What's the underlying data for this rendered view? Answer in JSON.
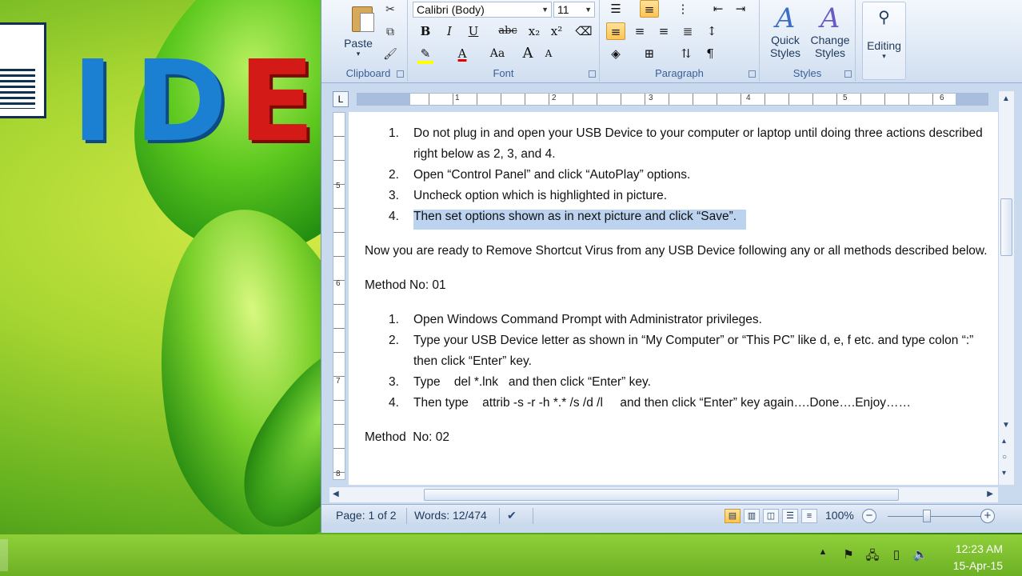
{
  "desktop": {
    "logo_letters": [
      "I",
      "D",
      "E"
    ]
  },
  "ribbon": {
    "clipboard": {
      "paste_label": "Paste",
      "group_label": "Clipboard"
    },
    "font": {
      "font_name": "Calibri (Body)",
      "font_size": "11",
      "group_label": "Font",
      "bold": "B",
      "italic": "I",
      "underline": "U",
      "strike": "abc",
      "subscript": "x₂",
      "superscript": "x²",
      "grow": "A",
      "shrink": "A",
      "change_case": "Aa"
    },
    "paragraph": {
      "group_label": "Paragraph",
      "show_marks": "¶"
    },
    "styles": {
      "quick_styles": "Quick Styles",
      "change_styles": "Change Styles",
      "group_label": "Styles"
    },
    "editing": {
      "label": "Editing"
    }
  },
  "ruler": {
    "numbers": [
      "1",
      "2",
      "3",
      "4",
      "5",
      "6"
    ],
    "vertical_numbers": [
      "5",
      "6",
      "7",
      "8"
    ]
  },
  "document": {
    "list1": [
      {
        "num": "1.",
        "text": "Do not plug in and open your USB Device to your computer or laptop until doing three actions described right below as 2, 3, and 4."
      },
      {
        "num": "2.",
        "text": "Open “Control Panel” and click “AutoPlay” options."
      },
      {
        "num": "3.",
        "text": "Uncheck option which is highlighted in picture."
      },
      {
        "num": "4.",
        "text": "Then set options shown as in next picture and click “Save”."
      }
    ],
    "paragraph": "Now you are ready to Remove Shortcut Virus from any USB Device following any or all methods described below.",
    "method1": "Method No: 01",
    "list2": [
      {
        "num": "1.",
        "text": "Open Windows Command Prompt with Administrator privileges."
      },
      {
        "num": "2.",
        "text": "Type your USB Device letter as shown in “My Computer” or “This PC” like d, e, f etc. and type colon “:” then click “Enter” key."
      },
      {
        "num": "3.",
        "text": "Type    del *.lnk   and then click “Enter” key."
      },
      {
        "num": "4.",
        "text": "Then type    attrib -s -r -h *.* /s /d /l     and then click “Enter” key again….Done….Enjoy……"
      }
    ],
    "method2": "Method  No: 02"
  },
  "status_bar": {
    "page": "Page: 1 of 2",
    "words": "Words: 12/474",
    "zoom": "100%"
  },
  "taskbar": {
    "time": "12:23 AM",
    "date": "15-Apr-15"
  }
}
